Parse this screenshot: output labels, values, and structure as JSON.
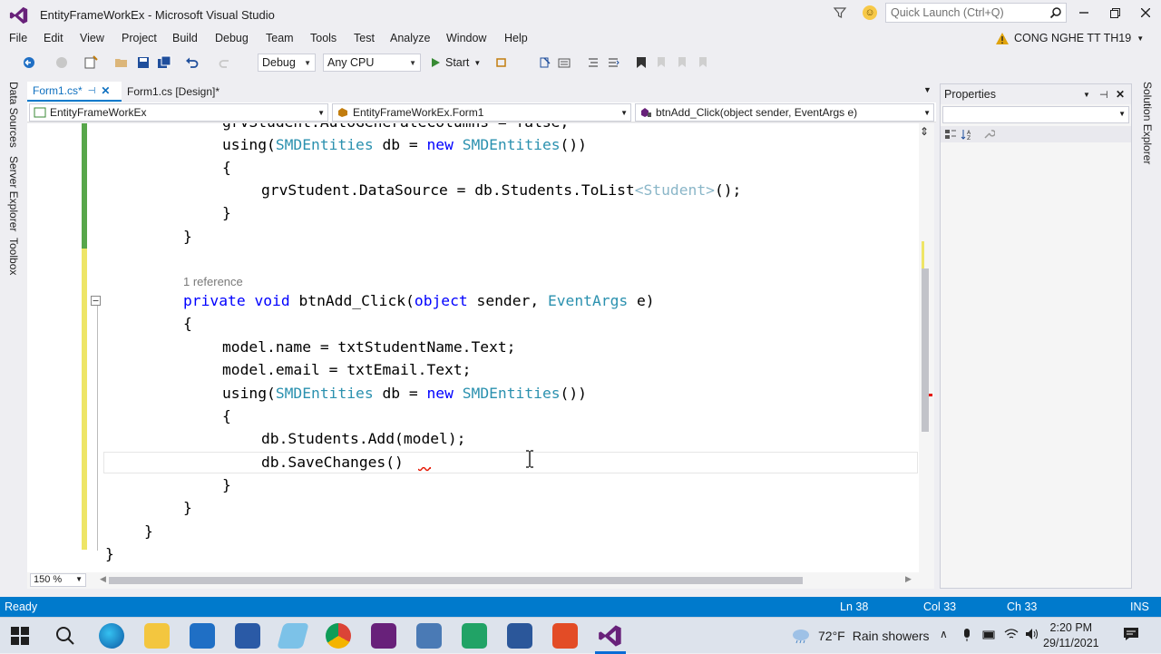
{
  "window": {
    "title": "EntityFrameWorkEx - Microsoft Visual Studio",
    "quick_launch_placeholder": "Quick Launch (Ctrl+Q)"
  },
  "menu": [
    "File",
    "Edit",
    "View",
    "Project",
    "Build",
    "Debug",
    "Team",
    "Tools",
    "Test",
    "Analyze",
    "Window",
    "Help"
  ],
  "account": {
    "name": "CONG NGHE TT TH19"
  },
  "toolbar": {
    "config": "Debug",
    "platform": "Any CPU",
    "start_label": "Start"
  },
  "left_rail": [
    "Data Sources",
    "Server Explorer",
    "Toolbox"
  ],
  "right_rail": [
    "Solution Explorer"
  ],
  "tabs": [
    {
      "label": "Form1.cs*",
      "active": true
    },
    {
      "label": "Form1.cs [Design]*",
      "active": false
    }
  ],
  "navbar": {
    "project": "EntityFrameWorkEx",
    "class": "EntityFrameWorkEx.Form1",
    "member": "btnAdd_Click(object sender, EventArgs e)"
  },
  "code": {
    "l0": "grvStudent.AutoGenerateColumns = false;",
    "l1a": "using(",
    "l1b": "SMDEntities",
    "l1c": " db = ",
    "l1d": "new",
    "l1e": " ",
    "l1f": "SMDEntities",
    "l1g": "())",
    "l2": "{",
    "l3a": "grvStudent.DataSource = db.Students.ToList",
    "l3b": "<Student>",
    "l3c": "();",
    "l4": "}",
    "l5": "}",
    "ref": "1 reference",
    "l7a": "private",
    "l7b": "void",
    "l7c": " btnAdd_Click(",
    "l7d": "object",
    "l7e": " sender, ",
    "l7f": "EventArgs",
    "l7g": " e)",
    "l8": "{",
    "l9": "model.name = txtStudentName.Text;",
    "l10": "model.email = txtEmail.Text;",
    "l11a": "using(",
    "l11b": "SMDEntities",
    "l11c": " db = ",
    "l11d": "new",
    "l11e": " ",
    "l11f": "SMDEntities",
    "l11g": "())",
    "l12": "{",
    "l13": "db.Students.Add(model);",
    "l14": "db.SaveChanges()",
    "l15": "}",
    "l16": "}",
    "l17": "}",
    "l18": "}"
  },
  "zoom": "150 %",
  "properties": {
    "title": "Properties"
  },
  "status": {
    "ready": "Ready",
    "ln": "Ln 38",
    "col": "Col 33",
    "ch": "Ch 33",
    "mode": "INS"
  },
  "taskbar": {
    "weather_temp": "72°F",
    "weather_desc": "Rain showers",
    "time": "2:20 PM",
    "date": "29/11/2021"
  },
  "colors": {
    "accent": "#007acc",
    "keyword": "#0000ff",
    "type": "#2b91af",
    "changed_saved": "#57a64a",
    "changed_unsaved": "#eee566"
  }
}
